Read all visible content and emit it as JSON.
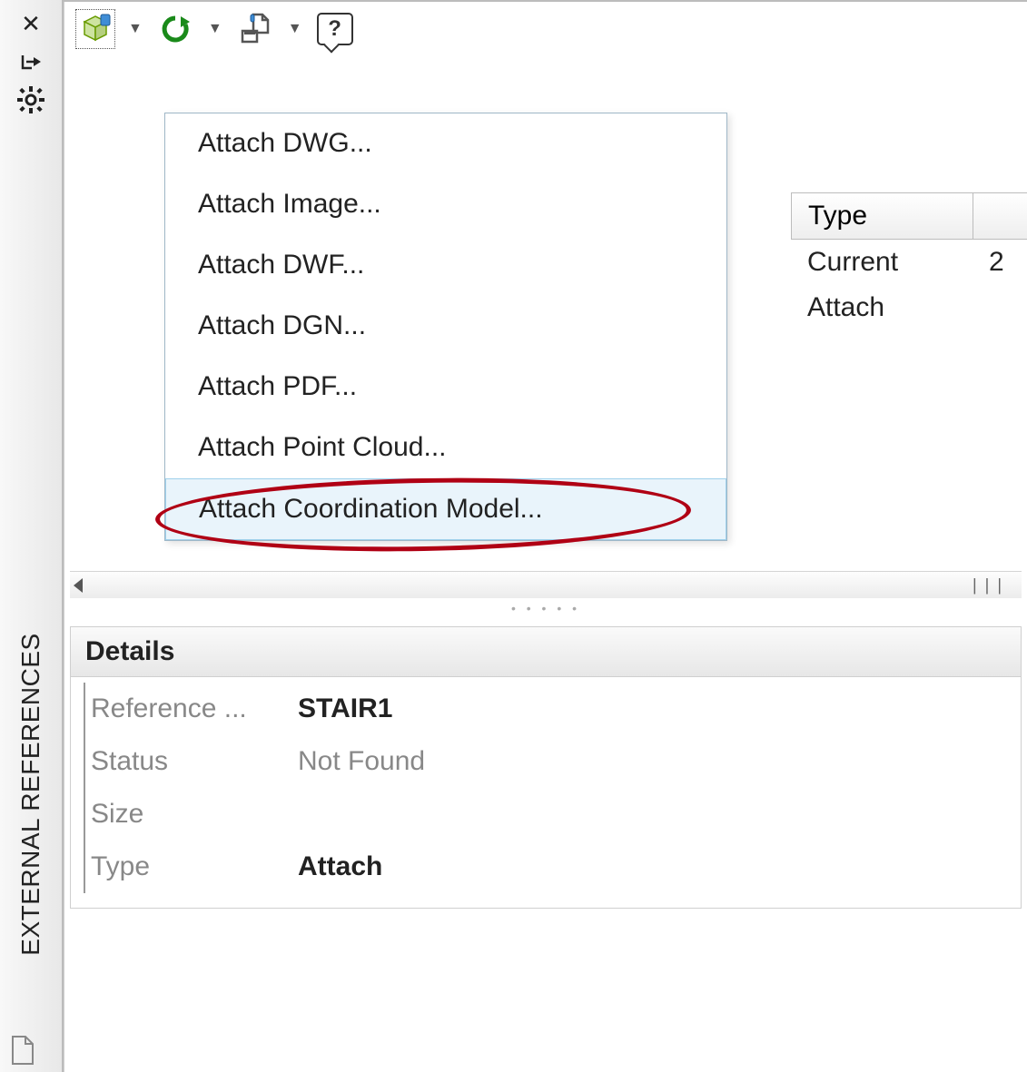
{
  "palette_title": "EXTERNAL REFERENCES",
  "toolbar": {
    "attach_dropdown": {
      "items": [
        "Attach DWG...",
        "Attach Image...",
        "Attach DWF...",
        "Attach DGN...",
        "Attach PDF...",
        "Attach Point Cloud...",
        "Attach Coordination Model..."
      ],
      "highlighted_index": 6
    }
  },
  "table": {
    "headers": [
      "Type"
    ],
    "rows": [
      {
        "type": "Current"
      },
      {
        "type": "Attach"
      }
    ]
  },
  "details": {
    "title": "Details",
    "rows": [
      {
        "label": "Reference ...",
        "value": "STAIR1"
      },
      {
        "label": "Status",
        "value": "Not Found",
        "muted": true
      },
      {
        "label": "Size",
        "value": ""
      },
      {
        "label": "Type",
        "value": "Attach"
      }
    ]
  },
  "annotation": {
    "circled_item_label": "Attach Coordination Model..."
  }
}
